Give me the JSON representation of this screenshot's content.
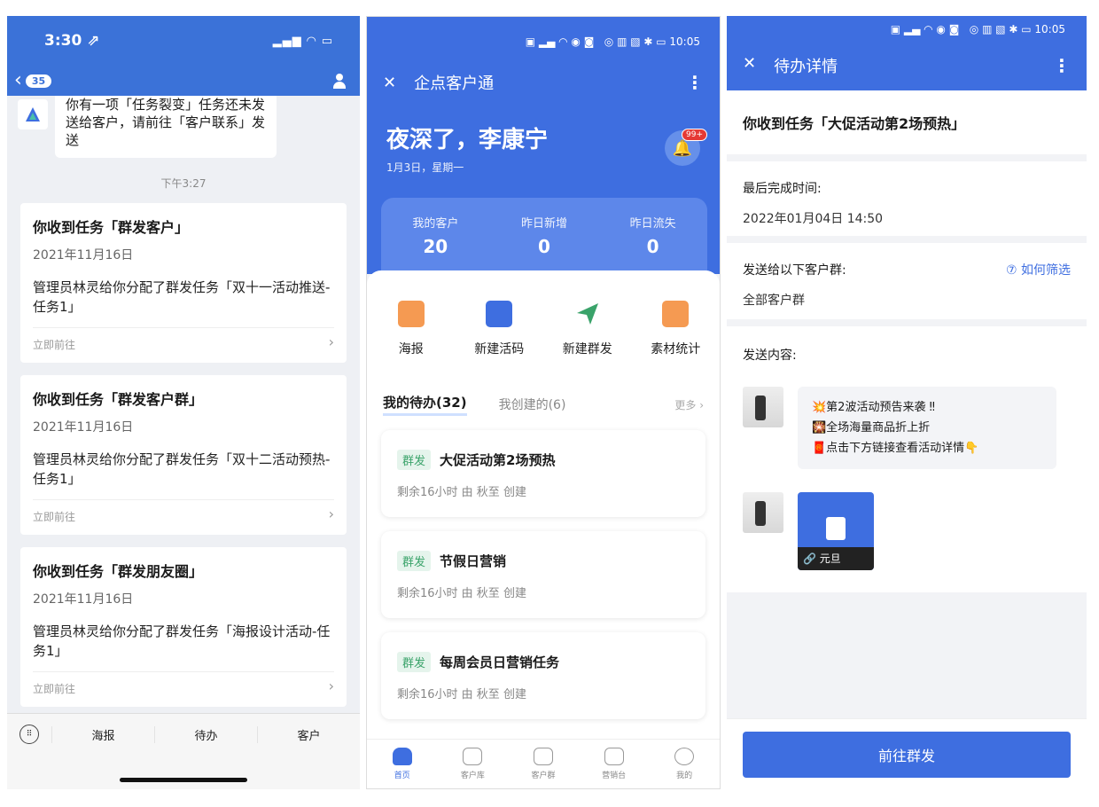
{
  "p1": {
    "status": {
      "time": "3:30 ⇗"
    },
    "nav": {
      "badge": "35"
    },
    "bot_text": "你有一项「任务裂变」任务还未发送给客户，请前往「客户联系」发送",
    "time": "下午3:27",
    "cards": [
      {
        "title": "你收到任务「群发客户」",
        "date": "2021年11月16日",
        "body": "管理员林灵给你分配了群发任务「双十一活动推送-任务1」",
        "go": "立即前往"
      },
      {
        "title": "你收到任务「群发客户群」",
        "date": "2021年11月16日",
        "body": "管理员林灵给你分配了群发任务「双十二活动预热-任务1」",
        "go": "立即前往"
      },
      {
        "title": "你收到任务「群发朋友圈」",
        "date": "2021年11月16日",
        "body": "管理员林灵给你分配了群发任务「海报设计活动-任务1」",
        "go": "立即前往"
      }
    ],
    "tabs": [
      "海报",
      "待办",
      "客户"
    ]
  },
  "p2": {
    "status": "10:05",
    "title": "企点客户通",
    "greeting": "夜深了，李康宁",
    "date": "1月3日，星期一",
    "bell_badge": "99+",
    "stats": [
      {
        "label": "我的客户",
        "value": "20"
      },
      {
        "label": "昨日新增",
        "value": "0"
      },
      {
        "label": "昨日流失",
        "value": "0"
      }
    ],
    "quick": [
      "海报",
      "新建活码",
      "新建群发",
      "素材统计"
    ],
    "tab_active": "我的待办(32)",
    "tab_other": "我创建的(6)",
    "more": "更多",
    "todos": [
      {
        "tag": "群发",
        "title": "大促活动第2场预热",
        "sub": "剩余16小时 由 秋至 创建"
      },
      {
        "tag": "群发",
        "title": "节假日营销",
        "sub": "剩余16小时 由 秋至 创建"
      },
      {
        "tag": "群发",
        "title": "每周会员日营销任务",
        "sub": "剩余16小时 由 秋至 创建"
      }
    ],
    "tabbar": [
      "首页",
      "客户库",
      "客户群",
      "营销台",
      "我的"
    ]
  },
  "p3": {
    "status": "10:05",
    "title": "待办详情",
    "heading": "你收到任务「大促活动第2场预热」",
    "deadline_label": "最后完成时间:",
    "deadline": "2022年01月04日 14:50",
    "send_to_label": "发送给以下客户群:",
    "how": "⑦ 如何筛选",
    "send_to": "全部客户群",
    "content_label": "发送内容:",
    "lines": [
      "💥第2波活动预告来袭 ‼",
      "🎇全场海量商品折上折",
      "🧧点击下方链接查看活动详情👇"
    ],
    "link_card": "🔗 元旦",
    "button": "前往群发"
  },
  "colors": {
    "primary": "#3e6ee0",
    "tag_green": "#3aa36a"
  }
}
